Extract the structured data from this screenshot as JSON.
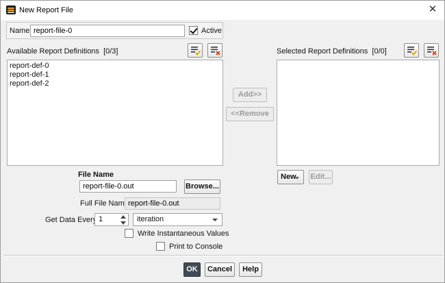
{
  "window": {
    "title": "New Report File",
    "close_icon": "close-icon"
  },
  "name_group": {
    "label": "Name",
    "value": "report-file-0",
    "active_label": "Active",
    "active_checked": true
  },
  "available": {
    "label": "Available Report Definitions",
    "count": "[0/3]",
    "items": [
      "report-def-0",
      "report-def-1",
      "report-def-2"
    ],
    "select_all_icon": "select-all-icon",
    "deselect_all_icon": "deselect-all-icon"
  },
  "selected": {
    "label": "Selected Report Definitions",
    "count": "[0/0]",
    "items": [],
    "select_all_icon": "select-all-icon",
    "deselect_all_icon": "deselect-all-icon"
  },
  "transfer": {
    "add_label": "Add>>",
    "remove_label": "<<Remove"
  },
  "definition_actions": {
    "new_label": "New",
    "edit_label": "Edit..."
  },
  "file": {
    "heading": "File Name",
    "file_name_value": "report-file-0.out",
    "browse_label": "Browse...",
    "full_file_name_label": "Full File Name",
    "full_file_name_value": "report-file-0.out",
    "get_data_every_label": "Get Data Every",
    "get_data_every_value": "1",
    "frequency_unit": "iteration",
    "write_instantaneous_label": "Write Instantaneous Values",
    "write_instantaneous_checked": false,
    "print_console_label": "Print to Console",
    "print_console_checked": false
  },
  "footer": {
    "ok_label": "OK",
    "cancel_label": "Cancel",
    "help_label": "Help"
  },
  "colors": {
    "ok_button": "#3f4a54",
    "dialog_bg": "#f0f0f0",
    "check_icon_accent": "#e0a800",
    "clear_icon_accent": "#d04a1a"
  }
}
